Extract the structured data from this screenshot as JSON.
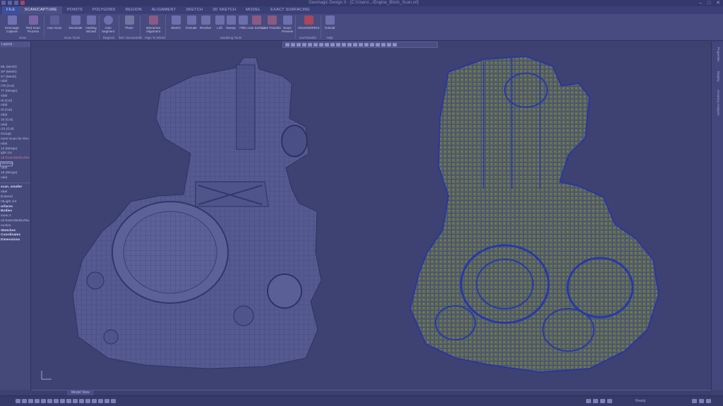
{
  "window": {
    "title": "Geomagic Design X - [C:\\Users\\...\\Engine_Block_Scan.xrl]",
    "minimize": "–",
    "maximize": "□",
    "close": "✕"
  },
  "ribbon": {
    "file_tab": "FILE",
    "tabs": [
      "SCAN/CAPTURE",
      "POINTS",
      "POLYGONS",
      "REGION",
      "ALIGNMENT",
      "SKETCH",
      "3D SKETCH",
      "MODEL",
      "EXACT SURFACING"
    ],
    "active_tab": "SCAN/CAPTURE",
    "buttons": [
      {
        "label": "Geomagic Capture",
        "icon": "capture-icon"
      },
      {
        "label": "Red Scan Process",
        "icon": "scan-process-icon"
      },
      {
        "label": "Auto Scan",
        "icon": "auto-scan-icon"
      },
      {
        "label": "Decimate",
        "icon": "decimate-icon"
      },
      {
        "label": "Healing Wizard",
        "icon": "healing-icon"
      },
      {
        "label": "Auto Segment",
        "icon": "segment-icon"
      },
      {
        "label": "Plane",
        "icon": "plane-icon"
      },
      {
        "label": "Interactive Alignment",
        "icon": "alignment-icon"
      },
      {
        "label": "Sketch",
        "icon": "sketch-icon"
      },
      {
        "label": "Extrude",
        "icon": "extrude-icon"
      },
      {
        "label": "Revolve",
        "icon": "revolve-icon"
      },
      {
        "label": "Loft",
        "icon": "loft-icon"
      },
      {
        "label": "Sweep",
        "icon": "sweep-icon"
      },
      {
        "label": "Fillet",
        "icon": "fillet-icon"
      },
      {
        "label": "Auto Surface",
        "icon": "auto-surface-icon"
      },
      {
        "label": "Live Transfer",
        "icon": "transfer-icon"
      },
      {
        "label": "Exact Preview",
        "icon": "preview-icon"
      },
      {
        "label": "SOLIDWORKS",
        "icon": "solidworks-icon"
      },
      {
        "label": "Tutorial",
        "icon": "tutorial-icon"
      }
    ],
    "groups": [
      "Scan",
      "Scan Tools",
      "Regions",
      "Ref. Geometries",
      "Align To World",
      "Modeling Tools",
      "LiveTransfer",
      "Help"
    ]
  },
  "left_panel": {
    "header": "Layout",
    "items": [
      {
        "text": "ML (Mesh)",
        "style": "normal"
      },
      {
        "text": "SP (Mesh)",
        "style": "normal"
      },
      {
        "text": "S7 (Mesh)",
        "style": "normal"
      },
      {
        "text": "ndal",
        "style": "normal"
      },
      {
        "text": "r76 (Cut)",
        "style": "normal"
      },
      {
        "text": "77 (Merge)",
        "style": "normal"
      },
      {
        "text": "ndal",
        "style": "normal"
      },
      {
        "text": "r8 (Cut)",
        "style": "normal"
      },
      {
        "text": "ndal",
        "style": "normal"
      },
      {
        "text": "r9 (Cut)",
        "style": "normal"
      },
      {
        "text": "ndal",
        "style": "normal"
      },
      {
        "text": "10 (Cut)",
        "style": "normal"
      },
      {
        "text": "ndal",
        "style": "normal"
      },
      {
        "text": "r11 (Cut)",
        "style": "normal"
      },
      {
        "text": "Group)",
        "style": "normal"
      },
      {
        "text": "ment Scan for Rev",
        "style": "normal"
      },
      {
        "text": "ndal",
        "style": "normal"
      },
      {
        "text": "13 (Merge)",
        "style": "normal"
      },
      {
        "text": "ight 1/4",
        "style": "normal"
      },
      {
        "text": "nd ExtendedSurfac",
        "style": "red"
      },
      {
        "text": "Meshes",
        "style": "boxed"
      },
      {
        "text": "ndal",
        "style": "normal"
      },
      {
        "text": "15 (Merge)",
        "style": "normal"
      },
      {
        "text": "ndal",
        "style": "normal"
      }
    ],
    "section": "scan_smaller",
    "section_items": [
      {
        "text": "ndal",
        "style": "normal"
      },
      {
        "text": "Entered",
        "style": "normal"
      },
      {
        "text": "ntLight 1/4",
        "style": "normal"
      },
      {
        "text": "urfaces",
        "style": "bold"
      },
      {
        "text": "Bodies",
        "style": "bold"
      },
      {
        "text": "ment 2",
        "style": "normal"
      },
      {
        "text": "nd ExtendedSurfac",
        "style": "normal"
      },
      {
        "text": "ruction",
        "style": "normal"
      },
      {
        "text": "Sketches",
        "style": "bold"
      },
      {
        "text": "Coordinates",
        "style": "bold"
      },
      {
        "text": "Dimensions",
        "style": "bold"
      }
    ]
  },
  "right_panel": {
    "tabs": [
      "Properties",
      "Display",
      "Accuracy Analyzer"
    ]
  },
  "viewport": {
    "tab": "Model View",
    "left_model": "polygon-mesh-engine",
    "right_model": "nurbs-surface-engine",
    "colors": {
      "background": "#3e4272",
      "mesh_shade": "#555a90",
      "wire_blue": "#2c3aa8",
      "wire_green": "#6e8a5a",
      "wire_orange": "#a07a46"
    }
  },
  "status_bar": {
    "text": "Ready"
  }
}
